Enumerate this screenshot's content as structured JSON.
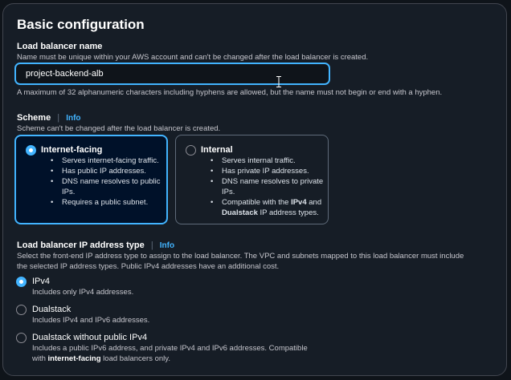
{
  "section": {
    "title": "Basic configuration"
  },
  "lb_name": {
    "label": "Load balancer name",
    "description": "Name must be unique within your AWS account and can't be changed after the load balancer is created.",
    "value": "project-backend-alb",
    "constraint": "A maximum of 32 alphanumeric characters including hyphens are allowed, but the name must not begin or end with a hyphen."
  },
  "scheme": {
    "label": "Scheme",
    "separator": "|",
    "info": "Info",
    "description": "Scheme can't be changed after the load balancer is created.",
    "options": [
      {
        "title": "Internet-facing",
        "selected": true,
        "bullets": [
          "Serves internet-facing traffic.",
          "Has public IP addresses.",
          "DNS name resolves to public IPs.",
          "Requires a public subnet."
        ]
      },
      {
        "title": "Internal",
        "selected": false,
        "bullets": [
          "Serves internal traffic.",
          "Has private IP addresses.",
          "DNS name resolves to private IPs."
        ],
        "compat_prefix": "Compatible with the ",
        "compat_b1": "IPv4",
        "compat_mid": " and ",
        "compat_b2": "Dualstack",
        "compat_suffix": " IP address types."
      }
    ]
  },
  "ip_type": {
    "label": "Load balancer IP address type",
    "separator": "|",
    "info": "Info",
    "description_line1": "Select the front-end IP address type to assign to the load balancer. The VPC and subnets mapped to this load balancer must include",
    "description_line2": "the selected IP address types. Public IPv4 addresses have an additional cost.",
    "options": [
      {
        "title": "IPv4",
        "desc": "Includes only IPv4 addresses.",
        "selected": true
      },
      {
        "title": "Dualstack",
        "desc": "Includes IPv4 and IPv6 addresses.",
        "selected": false
      },
      {
        "title": "Dualstack without public IPv4",
        "desc_line1": "Includes a public IPv6 address, and private IPv4 and IPv6 addresses. Compatible",
        "desc_pre": "with ",
        "desc_bold": "internet-facing",
        "desc_post": " load balancers only.",
        "selected": false
      }
    ]
  },
  "colors": {
    "accent": "#42b4ff",
    "panel_bg": "#161d26",
    "selected_card_bg": "#001129"
  }
}
